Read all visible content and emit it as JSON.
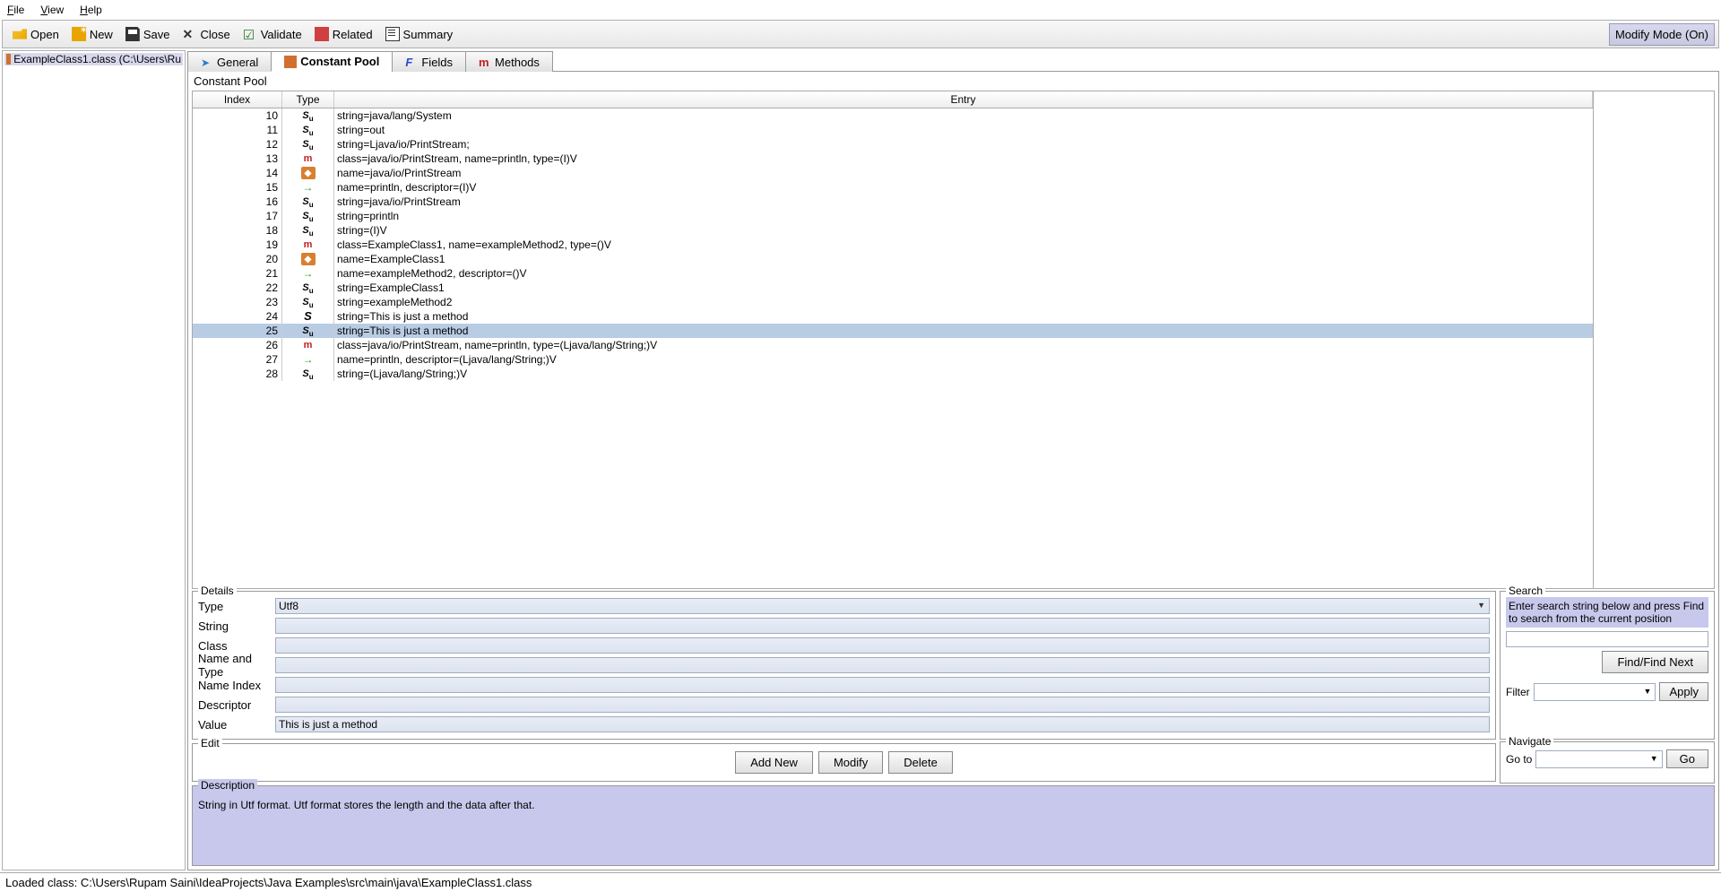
{
  "menu": {
    "file": "File",
    "file_u": "F",
    "view": "View",
    "view_u": "V",
    "help": "Help",
    "help_u": "H"
  },
  "toolbar": {
    "open": "Open",
    "new": "New",
    "save": "Save",
    "close": "Close",
    "validate": "Validate",
    "related": "Related",
    "summary": "Summary",
    "modify": "Modify Mode (On)"
  },
  "tree": {
    "item0": "ExampleClass1.class (C:\\Users\\Ru"
  },
  "tabs": {
    "general": "General",
    "cpool": "Constant Pool",
    "fields": "Fields",
    "methods": "Methods"
  },
  "section": {
    "cpool": "Constant Pool"
  },
  "thead": {
    "index": "Index",
    "type": "Type",
    "entry": "Entry"
  },
  "rows": [
    {
      "idx": "10",
      "t": "s",
      "e": "string=java/lang/System"
    },
    {
      "idx": "11",
      "t": "s",
      "e": "string=out"
    },
    {
      "idx": "12",
      "t": "s",
      "e": "string=Ljava/io/PrintStream;"
    },
    {
      "idx": "13",
      "t": "m",
      "e": "class=java/io/PrintStream, name=println, type=(I)V"
    },
    {
      "idx": "14",
      "t": "c",
      "e": "name=java/io/PrintStream"
    },
    {
      "idx": "15",
      "t": "nt",
      "e": "name=println, descriptor=(I)V"
    },
    {
      "idx": "16",
      "t": "s",
      "e": "string=java/io/PrintStream"
    },
    {
      "idx": "17",
      "t": "s",
      "e": "string=println"
    },
    {
      "idx": "18",
      "t": "s",
      "e": "string=(I)V"
    },
    {
      "idx": "19",
      "t": "m",
      "e": "class=ExampleClass1, name=exampleMethod2, type=()V"
    },
    {
      "idx": "20",
      "t": "c",
      "e": "name=ExampleClass1"
    },
    {
      "idx": "21",
      "t": "nt",
      "e": "name=exampleMethod2, descriptor=()V"
    },
    {
      "idx": "22",
      "t": "s",
      "e": "string=ExampleClass1"
    },
    {
      "idx": "23",
      "t": "s",
      "e": "string=exampleMethod2"
    },
    {
      "idx": "24",
      "t": "S",
      "e": "string=This is just a method"
    },
    {
      "idx": "25",
      "t": "s",
      "e": "string=This is just a method",
      "sel": true
    },
    {
      "idx": "26",
      "t": "m",
      "e": "class=java/io/PrintStream, name=println, type=(Ljava/lang/String;)V"
    },
    {
      "idx": "27",
      "t": "nt",
      "e": "name=println, descriptor=(Ljava/lang/String;)V"
    },
    {
      "idx": "28",
      "t": "s",
      "e": "string=(Ljava/lang/String;)V"
    }
  ],
  "details": {
    "title": "Details",
    "type_l": "Type",
    "type_v": "Utf8",
    "string_l": "String",
    "class_l": "Class",
    "nat_l": "Name and Type",
    "nidx_l": "Name Index",
    "desc_l": "Descriptor",
    "value_l": "Value",
    "value_v": "This is just a method"
  },
  "search": {
    "title": "Search",
    "hint": "Enter search string below and press Find to search from the current position",
    "find": "Find/Find Next",
    "filter_l": "Filter",
    "apply": "Apply"
  },
  "edit": {
    "title": "Edit",
    "add": "Add New",
    "modify": "Modify",
    "delete": "Delete"
  },
  "nav": {
    "title": "Navigate",
    "goto_l": "Go to",
    "go": "Go"
  },
  "desc": {
    "title": "Description",
    "text": "String in Utf format. Utf format stores the length and the data after that."
  },
  "status": "Loaded class: C:\\Users\\Rupam Saini\\IdeaProjects\\Java Examples\\src\\main\\java\\ExampleClass1.class"
}
